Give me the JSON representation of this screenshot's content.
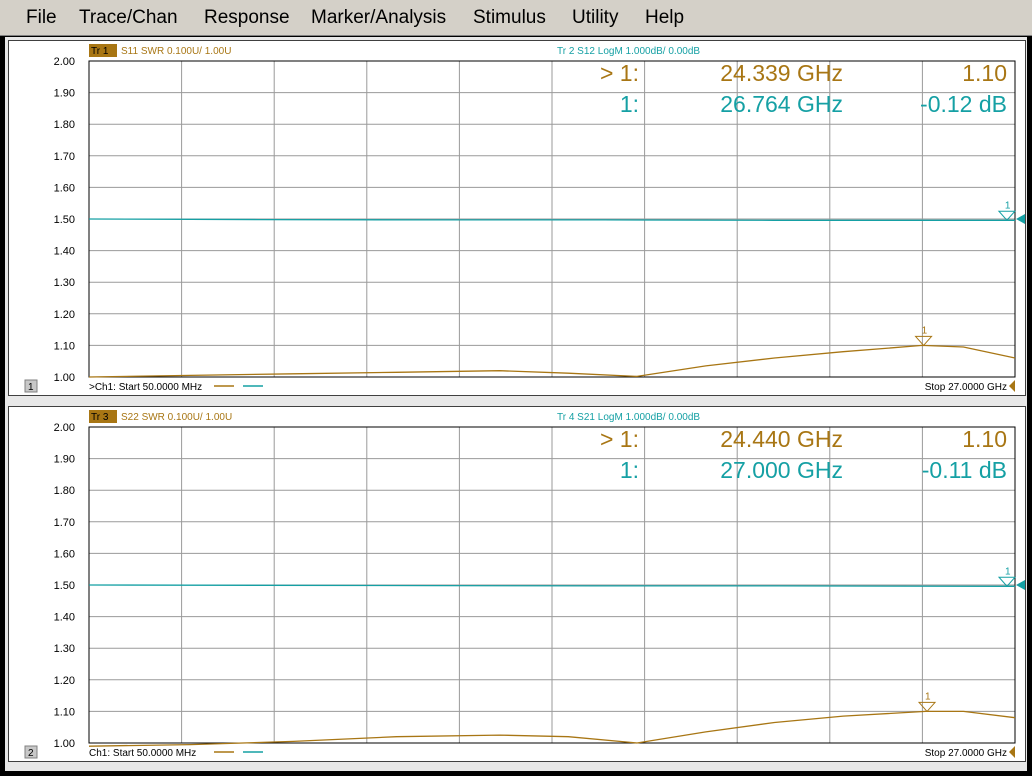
{
  "menu": [
    "File",
    "Trace/Chan",
    "Response",
    "Marker/Analysis",
    "Stimulus",
    "Utility",
    "Help"
  ],
  "colors": {
    "swr": "#a87614",
    "logm": "#15a0a4",
    "grid": "#9a9a9a",
    "marker_bg": "#a87614"
  },
  "chart_data": [
    {
      "type": "line",
      "window": "1",
      "trace_primary": {
        "tag": "Tr 1",
        "label": "S11 SWR 0.100U/ 1.00U"
      },
      "trace_secondary": {
        "label": "Tr 2  S12 LogM 1.000dB/ 0.00dB"
      },
      "yticks": [
        "2.00",
        "1.90",
        "1.80",
        "1.70",
        "1.60",
        "1.50",
        "1.40",
        "1.30",
        "1.20",
        "1.10",
        "1.00"
      ],
      "ylim": [
        1.0,
        2.0
      ],
      "xlim_ghz": [
        0.05,
        27.0
      ],
      "grid": true,
      "start_label": ">Ch1: Start  50.0000 MHz",
      "stop_label": "Stop  27.0000 GHz",
      "markers": [
        {
          "prefix": "> 1:",
          "freq": "24.339 GHz",
          "value": "1.10",
          "series": "swr"
        },
        {
          "prefix": "1:",
          "freq": "26.764 GHz",
          "value": "-0.12 dB",
          "series": "logm"
        }
      ],
      "series": [
        {
          "color_key": "swr",
          "x": [
            0.05,
            3.0,
            6.0,
            9.0,
            12.0,
            14.0,
            16.0,
            18.0,
            20.0,
            22.0,
            24.3,
            25.5,
            27.0
          ],
          "y": [
            1.0,
            1.005,
            1.01,
            1.015,
            1.02,
            1.012,
            1.002,
            1.035,
            1.06,
            1.08,
            1.1,
            1.095,
            1.06
          ]
        },
        {
          "color_key": "logm",
          "x": [
            0.05,
            5.0,
            10.0,
            15.0,
            20.0,
            27.0
          ],
          "y": [
            1.5,
            1.498,
            1.497,
            1.497,
            1.496,
            1.496
          ]
        }
      ],
      "marker_pos": [
        {
          "series": "swr",
          "x": 24.339,
          "y": 1.1,
          "label": "1"
        },
        {
          "series": "logm",
          "x": 26.764,
          "y": 1.496,
          "label": "1"
        }
      ]
    },
    {
      "type": "line",
      "window": "2",
      "trace_primary": {
        "tag": "Tr 3",
        "label": "S22 SWR 0.100U/ 1.00U"
      },
      "trace_secondary": {
        "label": "Tr 4  S21 LogM 1.000dB/ 0.00dB"
      },
      "yticks": [
        "2.00",
        "1.90",
        "1.80",
        "1.70",
        "1.60",
        "1.50",
        "1.40",
        "1.30",
        "1.20",
        "1.10",
        "1.00"
      ],
      "ylim": [
        1.0,
        2.0
      ],
      "xlim_ghz": [
        0.05,
        27.0
      ],
      "grid": true,
      "start_label": "Ch1: Start  50.0000 MHz",
      "stop_label": "Stop  27.0000 GHz",
      "markers": [
        {
          "prefix": "> 1:",
          "freq": "24.440 GHz",
          "value": "1.10",
          "series": "swr"
        },
        {
          "prefix": "1:",
          "freq": "27.000 GHz",
          "value": "-0.11 dB",
          "series": "logm"
        }
      ],
      "series": [
        {
          "color_key": "swr",
          "x": [
            0.05,
            3.0,
            6.0,
            9.0,
            12.0,
            14.0,
            16.0,
            18.0,
            20.0,
            22.0,
            24.4,
            25.5,
            27.0
          ],
          "y": [
            0.99,
            0.995,
            1.005,
            1.02,
            1.025,
            1.02,
            1.0,
            1.035,
            1.065,
            1.085,
            1.1,
            1.1,
            1.08
          ]
        },
        {
          "color_key": "logm",
          "x": [
            0.05,
            5.0,
            10.0,
            15.0,
            20.0,
            27.0
          ],
          "y": [
            1.5,
            1.499,
            1.498,
            1.497,
            1.497,
            1.496
          ]
        }
      ],
      "marker_pos": [
        {
          "series": "swr",
          "x": 24.44,
          "y": 1.1,
          "label": "1"
        },
        {
          "series": "logm",
          "x": 27.0,
          "y": 1.496,
          "label": "1"
        }
      ]
    }
  ]
}
